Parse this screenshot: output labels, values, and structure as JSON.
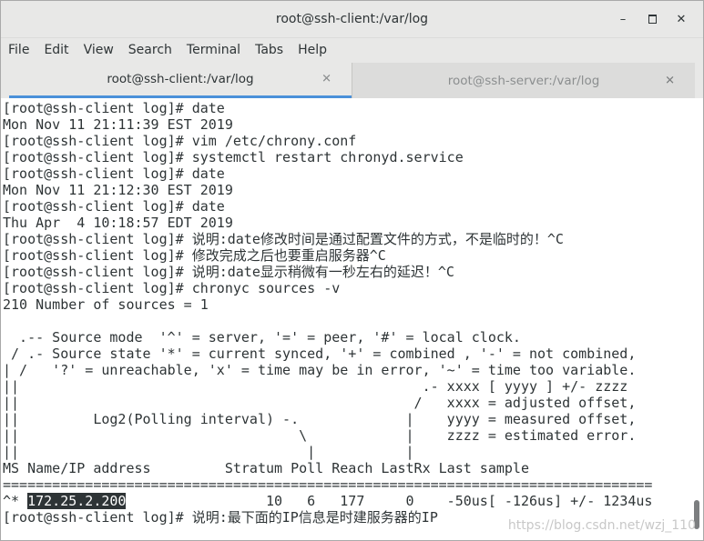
{
  "window": {
    "title": "root@ssh-client:/var/log",
    "controls": {
      "minimize": "–",
      "close": "✕"
    }
  },
  "menu": [
    "File",
    "Edit",
    "View",
    "Search",
    "Terminal",
    "Tabs",
    "Help"
  ],
  "tabs": [
    {
      "label": "root@ssh-client:/var/log",
      "close": "✕",
      "active": true
    },
    {
      "label": "root@ssh-server:/var/log",
      "close": "✕",
      "active": false
    }
  ],
  "terminal": {
    "lines": [
      "[root@ssh-client log]# date",
      "Mon Nov 11 21:11:39 EST 2019",
      "[root@ssh-client log]# vim /etc/chrony.conf",
      "[root@ssh-client log]# systemctl restart chronyd.service",
      "[root@ssh-client log]# date",
      "Mon Nov 11 21:12:30 EST 2019",
      "[root@ssh-client log]# date",
      "Thu Apr  4 10:18:57 EDT 2019",
      "[root@ssh-client log]# 说明:date修改时间是通过配置文件的方式，不是临时的！^C",
      "[root@ssh-client log]# 修改完成之后也要重启服务器^C",
      "[root@ssh-client log]# 说明:date显示稍微有一秒左右的延迟！^C",
      "[root@ssh-client log]# chronyc sources -v",
      "210 Number of sources = 1",
      "",
      "  .-- Source mode  '^' = server, '=' = peer, '#' = local clock.",
      " / .- Source state '*' = current synced, '+' = combined , '-' = not combined,",
      "| /   '?' = unreachable, 'x' = time may be in error, '~' = time too variable.",
      "||                                                 .- xxxx [ yyyy ] +/- zzzz",
      "||                                                /   xxxx = adjusted offset,",
      "||         Log2(Polling interval) -.             |    yyyy = measured offset,",
      "||                                  \\            |    zzzz = estimated error.",
      "||                                   |           |",
      "MS Name/IP address         Stratum Poll Reach LastRx Last sample",
      "==============================================================================="
    ],
    "source_row": {
      "prefix": "^* ",
      "address": "172.25.2.200",
      "rest": "                 10   6   177     0    -50us[ -126us] +/- 1234us"
    },
    "last_line": "[root@ssh-client log]# 说明:最下面的IP信息是时建服务器的IP"
  },
  "watermark": "https://blog.csdn.net/wzj_110"
}
